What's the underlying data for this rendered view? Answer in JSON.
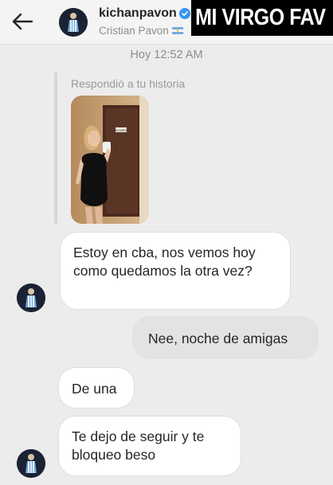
{
  "header": {
    "back_icon": "arrow-left-icon",
    "username": "kichanpavon",
    "verified_icon": "verified-badge-icon",
    "full_name": "Cristian Pavon",
    "flag_icon": "argentina-flag-icon"
  },
  "story_overlay_text": "MI VIRGO FAV",
  "timestamp": "Hoy 12:52 AM",
  "story_reply": {
    "label": "Respondió a tu historia",
    "door_sign": "ROMER"
  },
  "messages": [
    {
      "side": "received",
      "text": "Estoy en cba, nos vemos hoy como quedamos la otra vez?"
    },
    {
      "side": "sent",
      "text": "Nee, noche de amigas"
    },
    {
      "side": "received",
      "text": "De una"
    },
    {
      "side": "received",
      "text": "Te dejo de seguir y te bloqueo beso"
    }
  ],
  "colors": {
    "background": "#ececec",
    "verified": "#3897f0",
    "received_bubble": "#ffffff",
    "sent_bubble": "#e3e3e3",
    "meta_text": "#8e8e8e"
  }
}
